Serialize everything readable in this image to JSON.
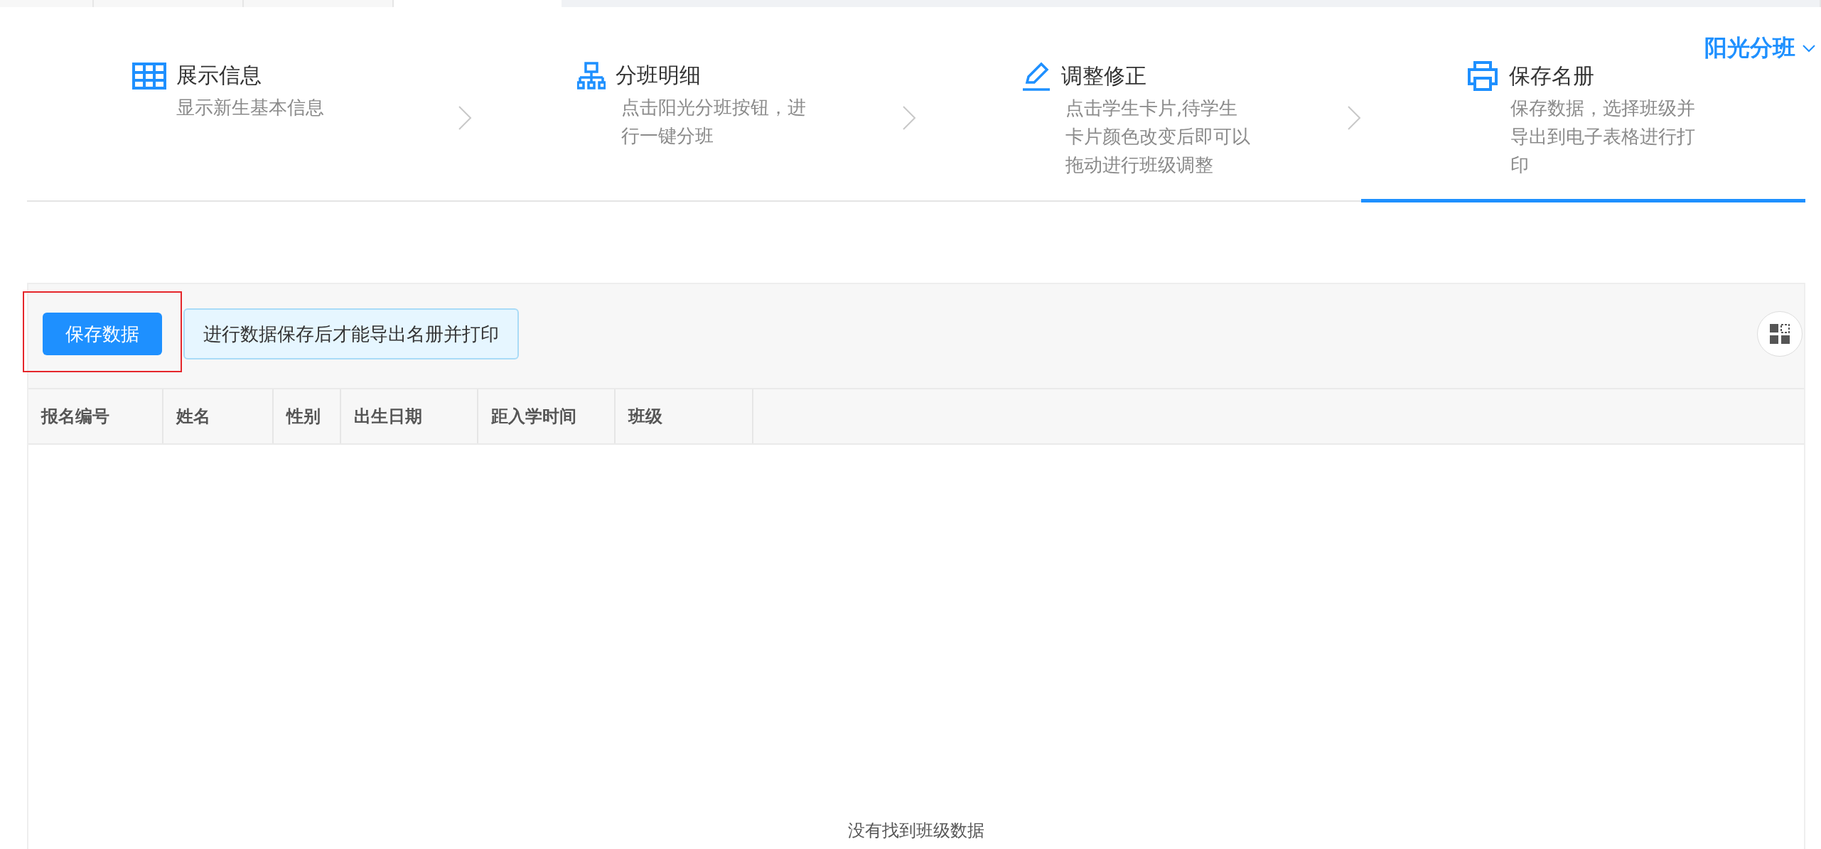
{
  "header": {
    "title": "阳光分班"
  },
  "steps": [
    {
      "title": "展示信息",
      "description": "显示新生基本信息",
      "selected": false
    },
    {
      "title": "分班明细",
      "description": "点击阳光分班按钮，进行一键分班",
      "selected": false
    },
    {
      "title": "调整修正",
      "description": "点击学生卡片,待学生卡片颜色改变后即可以拖动进行班级调整",
      "selected": false
    },
    {
      "title": "保存名册",
      "description": "保存数据，选择班级并导出到电子表格进行打印",
      "selected": true
    }
  ],
  "toolbar": {
    "save_button": "保存数据",
    "notice": "进行数据保存后才能导出名册并打印"
  },
  "table": {
    "columns": [
      "报名编号",
      "姓名",
      "性别",
      "出生日期",
      "距入学时间",
      "班级"
    ],
    "empty_text": "没有找到班级数据"
  }
}
